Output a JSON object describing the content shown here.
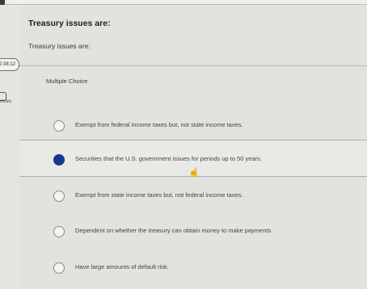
{
  "header": {
    "title": "Treasury issues are:"
  },
  "question": {
    "text": "Treasury issues are:",
    "type_label": "Multiple Choice"
  },
  "sidebar": {
    "timer": "2:38:12",
    "references_label": "ences"
  },
  "options": [
    {
      "label": "Exempt from federal income taxes but, not state income taxes.",
      "selected": false
    },
    {
      "label": "Securities that the U.S. government issues for periods up to 50 years.",
      "selected": true
    },
    {
      "label": "Exempt from state income taxes but, not federal income taxes.",
      "selected": false
    },
    {
      "label": "Dependent on whether the treasury can obtain money to make payments.",
      "selected": false
    },
    {
      "label": "Have large amounts of default risk.",
      "selected": false
    }
  ],
  "colors": {
    "accent": "#143a8f",
    "background": "#e1e3dc"
  }
}
